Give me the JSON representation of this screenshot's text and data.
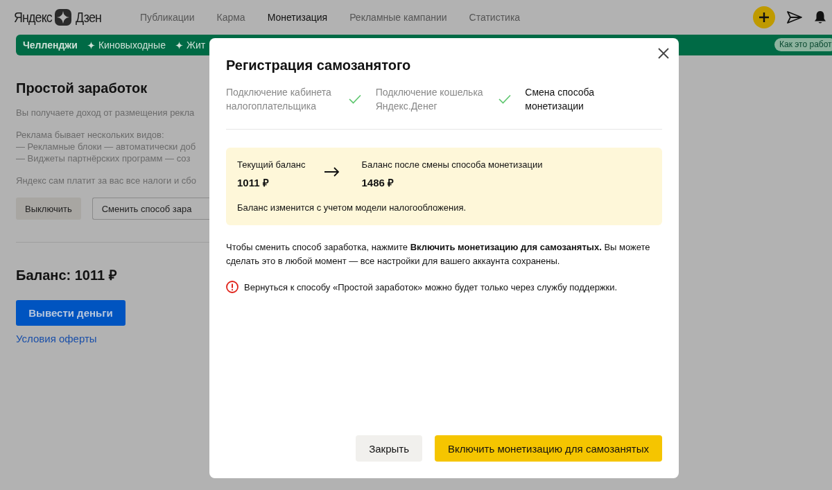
{
  "header": {
    "logo": {
      "left": "Яндекс",
      "right": "Дзен"
    },
    "nav": [
      {
        "label": "Публикации",
        "selected": false
      },
      {
        "label": "Карма",
        "selected": false
      },
      {
        "label": "Монетизация",
        "selected": true
      },
      {
        "label": "Рекламные кампании",
        "selected": false
      },
      {
        "label": "Статистика",
        "selected": false
      }
    ]
  },
  "banner": {
    "items": [
      {
        "label": "Челленджи",
        "kind": "title"
      },
      {
        "label": "Киновыходные",
        "kind": "tag"
      },
      {
        "label": "Жит",
        "kind": "tag"
      }
    ],
    "help_link": "Как это работ"
  },
  "page": {
    "title": "Простой заработок",
    "description": [
      [
        "Вы получаете доход от размещения рекла"
      ],
      [
        "Реклама бывает нескольких видов:",
        "— Рекламные блоки — автоматически доб",
        "— Виджеты партнёрских программ — соз"
      ],
      [
        "Яндекс сам платит за вас все налоги и сбо"
      ]
    ],
    "buttons": [
      {
        "label": "Выключить",
        "kind": "filled"
      },
      {
        "label": "Сменить способ зара",
        "kind": "outline"
      }
    ],
    "balance": "Баланс: 1011 ₽",
    "withdraw_button": "Вывести деньги",
    "offer_link": "Условия оферты"
  },
  "modal": {
    "title": "Регистрация самозанятого",
    "steps": [
      {
        "label": "Подключение кабинета налогоплательщика",
        "done": true
      },
      {
        "label": "Подключение кошелька Яндекс.Денег",
        "done": true
      },
      {
        "label": "Смена способа монетизации",
        "done": false
      }
    ],
    "current_balance_label": "Текущий баланс",
    "current_balance": "1011 ₽",
    "new_balance_label": "Баланс после смены способа монетизации",
    "new_balance": "1486 ₽",
    "balance_note": "Баланс изменится с учетом модели налогообложения.",
    "instructions": "Чтобы сменить способ заработка, нажмите **Включить монетизацию для самозанятых.** Вы можете сделать это в любой момент — все настройки для вашего аккаунта сохранены.",
    "warning": "Вернуться к способу «Простой заработок» можно будет только через службу поддержки.",
    "buttons": [
      {
        "label": "Закрыть",
        "kind": "secondary"
      },
      {
        "label": "Включить монетизацию для самозанятых",
        "kind": "primary"
      }
    ]
  }
}
